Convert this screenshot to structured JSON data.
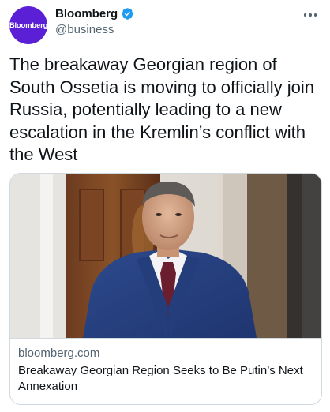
{
  "author": {
    "avatar_text": "Bloomberg",
    "display_name": "Bloomberg",
    "handle": "@business",
    "avatar_color": "#5b1fd6",
    "verified_color": "#1d9bf0"
  },
  "menu_icon": "more-horizontal-icon",
  "tweet": {
    "text": "The breakaway Georgian region of South Ossetia is moving to officially join Russia, potentially leading to a new escalation in the Kremlin’s conflict with the West"
  },
  "link_card": {
    "domain": "bloomberg.com",
    "title": "Breakaway Georgian Region Seeks to Be Putin’s Next Annexation"
  }
}
